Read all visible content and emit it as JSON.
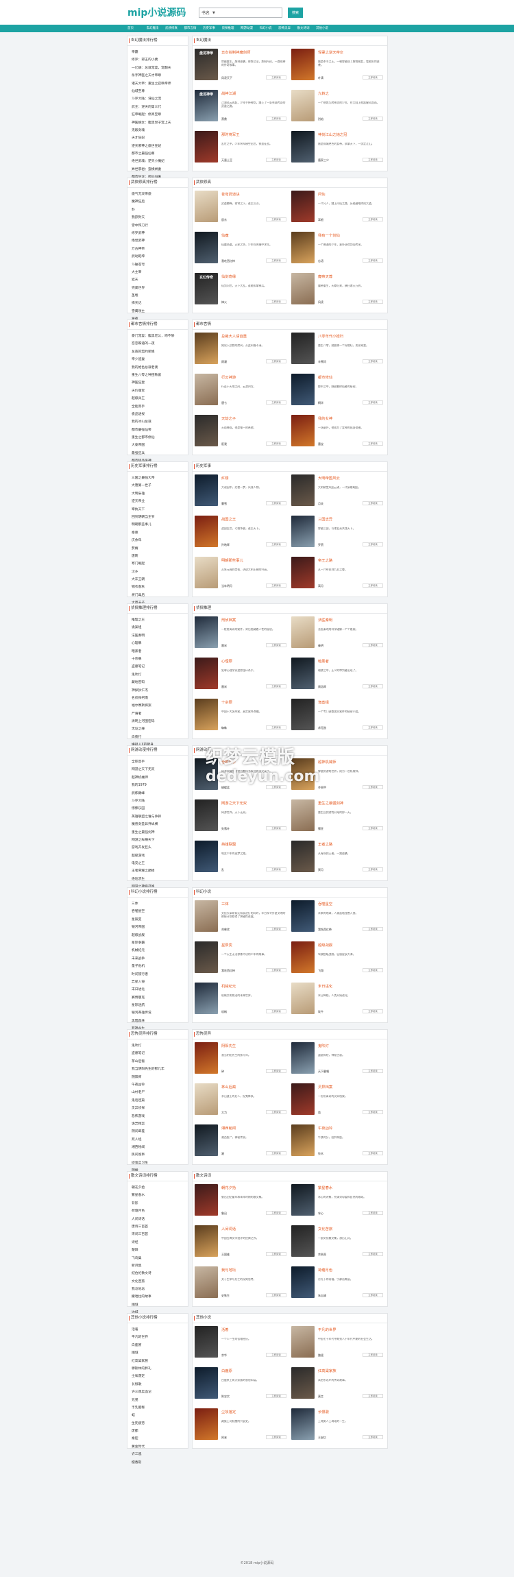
{
  "site": {
    "logo": "mip小说源码",
    "search_select": "书名",
    "search_button": "搜索"
  },
  "nav": [
    "首页",
    "玄幻魔法",
    "武侠修真",
    "都市言情",
    "历史军事",
    "侦探推理",
    "网游动漫",
    "科幻小说",
    "恐怖灵异",
    "散文诗词",
    "其他小说"
  ],
  "read_label": "立即阅读",
  "sections": [
    {
      "rank_title": "玄幻魔法排行榜",
      "cat_title": "玄幻魔法",
      "rank": [
        "帝霸",
        "修罗：邪王的小姨",
        "一亿嫡：总裁宠妻，宠翻天",
        "杀手神医之天才帝尊",
        "诸天大帝：重生之召唤帝师",
        "仙城至尊",
        "斗罗大陆：诛仙之宠",
        "武王：逆天的第三代",
        "狂帝崛起：修真至尊",
        "神医嫡女：腹黑世子宠上天",
        "无敌剑魂",
        "天才狂妃",
        "逆天邪神之傲世狂妃",
        "都市之最强仙尊",
        "绝世武魂：逆天小魔妃",
        "异世邪君：蛮横娇妻",
        "都市狂龙：修仙归来",
        "天道至尊"
      ],
      "books": [
        {
          "cover": "盘龙神帝",
          "title": "丑女控制神魔剑师",
          "author": "风凌天下",
          "desc": "穿越重生，废材逆袭，修炼功法，炼制丹药，一路成神的传奇故事。"
        },
        {
          "cover": "",
          "title": "悍妻之逆天帝女",
          "author": "叶清",
          "desc": "她是杀手之王，一朝穿越成了废物嫡女，看她如何逆袭。"
        },
        {
          "cover": "盘龙神帝",
          "title": "战神江湖",
          "author": "萧鼎",
          "desc": "江湖风云再起，少年手持神剑，踏上了一条充满传奇的武道之路。"
        },
        {
          "cover": "",
          "title": "九转之",
          "author": "烈焰",
          "desc": "一个修炼九转神功的少年，在大陆上掀起腥风血雨。"
        },
        {
          "cover": "",
          "title": "那时将军王",
          "author": "天蚕土豆",
          "desc": "乱世之中，少年将军横空出世，铁血征战。"
        },
        {
          "cover": "",
          "title": "神剑江山之她之冠",
          "author": "唐家三少",
          "desc": "她是倾城绝色的女帝，执掌天下，一剑定江山。"
        }
      ]
    },
    {
      "rank_title": "武侠修真排行榜",
      "cat_title": "武侠修真",
      "rank": [
        "傲气无双帝傲",
        "魔神狂后",
        "卦",
        "我欲封天",
        "雪中悍刀行",
        "修罗武神",
        "绝世武神",
        "万古神帝",
        "武动乾坤",
        "斗破苍穹",
        "大主宰",
        "遮天",
        "完美世界",
        "圣墟",
        "择天记",
        "雪鹰领主",
        "将夜",
        "龙王传说"
      ],
      "books": [
        {
          "cover": "",
          "title": "苍穹武道诀",
          "author": "辰东",
          "desc": "武道巅峰，苍穹之下，谁主沉浮。"
        },
        {
          "cover": "",
          "title": "问仙",
          "author": "耳根",
          "desc": "一介凡人，踏上问仙之路，历经磨难终成大道。"
        },
        {
          "cover": "",
          "title": "仙魔",
          "author": "我吃西红柿",
          "desc": "仙魔两道，正邪之争，少年在夹缝中求生。"
        },
        {
          "cover": "",
          "title": "我有一个剑仙",
          "author": "忘语",
          "desc": "一个普通的少年，意外获得剑仙传承。"
        },
        {
          "cover": "玄幻传奇",
          "title": "仙剑奇缘",
          "author": "烽火",
          "desc": "仙剑问世，天下大乱，谁能执掌神兵。"
        },
        {
          "cover": "",
          "title": "魔帝天尊",
          "author": "风凌",
          "desc": "魔帝重生，天尊归来，横扫诸天万界。"
        }
      ]
    },
    {
      "rank_title": "都市言情排行榜",
      "cat_title": "都市言情",
      "rank": [
        "豪门宠妻：腹黑老公，吻不够",
        "恋恋蝶语的一夜",
        "总裁的契约新娘",
        "帝少追妻",
        "我的绝色总裁老婆",
        "重生八零之种田致富",
        "神医狂妻",
        "天价萌宝",
        "超级兵王",
        "全能高手",
        "极品透视",
        "我的冰山总裁",
        "都市最强仙帝",
        "重生之都市修仙",
        "大秦帝国",
        "最强狂兵",
        "都市极品医神",
        "神级奶爸"
      ],
      "books": [
        {
          "cover": "",
          "title": "总裁大人请自重",
          "author": "顾漫",
          "desc": "她误入总裁的房间，从此纠缠不清。"
        },
        {
          "cover": "",
          "title": "八零年代小媳妇",
          "author": "辛夷坞",
          "desc": "重生八零，她要做一个好媳妇，发家致富。"
        },
        {
          "cover": "",
          "title": "行云神游",
          "author": "唐七",
          "desc": "行走于天地之间，云游四方。"
        },
        {
          "cover": "",
          "title": "都市修仙",
          "author": "桐华",
          "desc": "都市之中，隐藏着修仙者的秘密。"
        },
        {
          "cover": "",
          "title": "天劫之子",
          "author": "匪我",
          "desc": "天劫降临，他是唯一的希望。"
        },
        {
          "cover": "",
          "title": "我的女神",
          "author": "墨宝",
          "desc": "一场意外，他成为了女神的贴身保镖。"
        }
      ]
    },
    {
      "rank_title": "历史军事排行榜",
      "cat_title": "历史军事",
      "rank": [
        "三国之最强大帝",
        "大唐第一世子",
        "大明枭雄",
        "逆天帝业",
        "宰执天下",
        "回到明朝当王爷",
        "明朝那些事儿",
        "秦吏",
        "庆余年",
        "赘婿",
        "唐砖",
        "寒门崛起",
        "汉乡",
        "大宋王朝",
        "锦衣春秋",
        "将门毒后",
        "大周天子",
        "帝国风云"
      ],
      "books": [
        {
          "cover": "",
          "title": "红楼",
          "author": "曹雪",
          "desc": "大观园中，红楼一梦，风流人物。"
        },
        {
          "cover": "",
          "title": "大明帝国风云",
          "author": "月关",
          "desc": "大明朝堂风起云涌，一代枭雄崛起。"
        },
        {
          "cover": "",
          "title": "战国之王",
          "author": "孙皓晖",
          "desc": "战国乱世，七雄争霸，谁主天下。"
        },
        {
          "cover": "",
          "title": "三国志异",
          "author": "罗贯",
          "desc": "穿越三国，与诸葛亮共谋天下。"
        },
        {
          "cover": "",
          "title": "明朝那些事儿",
          "author": "当年明月",
          "desc": "从朱元璋到崇祯，讲述大明王朝的兴衰。"
        },
        {
          "cover": "",
          "title": "帝王之路",
          "author": "高月",
          "desc": "从一介布衣到九五之尊。"
        }
      ]
    },
    {
      "rank_title": "侦探推理排行榜",
      "cat_title": "侦探推理",
      "rank": [
        "推理之王",
        "诡案组",
        "法医秦明",
        "心理罪",
        "暗黑者",
        "十宗罪",
        "盗墓笔记",
        "鬼吹灯",
        "藏地密码",
        "神探狄仁杰",
        "名侦探柯南",
        "福尔摩斯探案",
        "尸语者",
        "清明上河图密码",
        "无证之罪",
        "白夜行",
        "嫌疑人X的献身",
        "恶意"
      ],
      "books": [
        {
          "cover": "",
          "title": "刑侦档案",
          "author": "雷米",
          "desc": "一桩桩离奇的案件，背后隐藏着人性的秘密。"
        },
        {
          "cover": "",
          "title": "法医秦明",
          "author": "秦明",
          "desc": "法医秦明用科学破解一个个悬案。"
        },
        {
          "cover": "",
          "title": "心理罪",
          "author": "雷米",
          "desc": "犯罪心理学家追踪连环杀手。"
        },
        {
          "cover": "",
          "title": "暗黑者",
          "author": "周浩晖",
          "desc": "暗夜之中，正义的审判者出现了。"
        },
        {
          "cover": "",
          "title": "十宗罪",
          "author": "蜘蛛",
          "desc": "中国十大凶杀案，真实案件改编。"
        },
        {
          "cover": "",
          "title": "诡案组",
          "author": "求无欲",
          "desc": "一个专门调查诡异案件的秘密小组。"
        }
      ]
    },
    {
      "rank_title": "网游动漫排行榜",
      "cat_title": "网游动漫",
      "rank": [
        "全职高手",
        "网游之天下无双",
        "超神机械师",
        "我的1979",
        "武炼巅峰",
        "斗罗大陆",
        "惊悚乐园",
        "英雄联盟之谁与争锋",
        "魔兽剑圣异界纵横",
        "重生之最强剑神",
        "网游之纵横天下",
        "游戏开发巨头",
        "超级游戏",
        "电竞之王",
        "王者荣耀之巅峰",
        "绝地求生",
        "网游之神级召唤",
        "全球高武"
      ],
      "books": [
        {
          "cover": "",
          "title": "全职高手",
          "author": "蝴蝶蓝",
          "desc": "网游荣耀中被誉为教科书级别的顶尖高手。"
        },
        {
          "cover": "",
          "title": "超神机械师",
          "author": "齐佩甲",
          "desc": "穿越到游戏世界，成为一名机械师。"
        },
        {
          "cover": "",
          "title": "网游之天下无双",
          "author": "失落叶",
          "desc": "网游世界，天下无双。"
        },
        {
          "cover": "",
          "title": "重生之最强剑神",
          "author": "蜀狂",
          "desc": "重生回到游戏开始的那一天。"
        },
        {
          "cover": "",
          "title": "英雄联盟",
          "author": "乱",
          "desc": "电竞少年的逐梦之路。"
        },
        {
          "cover": "",
          "title": "王者之路",
          "author": "冥月",
          "desc": "从青铜到王者，一路逆袭。"
        }
      ]
    },
    {
      "rank_title": "科幻小说排行榜",
      "cat_title": "科幻小说",
      "rank": [
        "三体",
        "吞噬星空",
        "星辰变",
        "银河帝国",
        "超级战舰",
        "星际争霸",
        "机械纪元",
        "未来战争",
        "量子危机",
        "时间旅行者",
        "异星入侵",
        "末日进化",
        "赛博朋克",
        "星际迷航",
        "银河英雄传说",
        "黑暗森林",
        "死神永生",
        "流浪地球"
      ],
      "books": [
        {
          "cover": "",
          "title": "三体",
          "author": "刘慈欣",
          "desc": "文化大革命如火如荼进行的同时，军方探寻外星文明的绝秘计划取得了突破性进展。"
        },
        {
          "cover": "",
          "title": "吞噬星空",
          "author": "我吃西红柿",
          "desc": "未来的地球，人类面临怪兽入侵。"
        },
        {
          "cover": "",
          "title": "星辰变",
          "author": "我吃西红柿",
          "desc": "一个天生无法修炼内功的少年的故事。"
        },
        {
          "cover": "",
          "title": "超级战舰",
          "author": "飞翔",
          "desc": "驾驶超级战舰，征服星辰大海。"
        },
        {
          "cover": "",
          "title": "机械纪元",
          "author": "机械",
          "desc": "机械文明统治的未来世界。"
        },
        {
          "cover": "",
          "title": "末日进化",
          "author": "吹牛",
          "desc": "末日降临，人类开始进化。"
        }
      ]
    },
    {
      "rank_title": "恐怖灵异排行榜",
      "cat_title": "恐怖灵异",
      "rank": [
        "鬼吹灯",
        "盗墓笔记",
        "茅山后裔",
        "我当阴阳先生的那几年",
        "阴阳师",
        "午夜凶铃",
        "山村老尸",
        "鬼话连篇",
        "灵异侦探",
        "恐怖游戏",
        "诡异档案",
        "阴间邮差",
        "死人经",
        "湘西秘闻",
        "民间诡事",
        "捉鬼实习生",
        "阴婚",
        "冥婚"
      ],
      "books": [
        {
          "cover": "",
          "title": "阴阳先生",
          "author": "钟",
          "desc": "我当阴阳先生的那几年。"
        },
        {
          "cover": "",
          "title": "鬼吹灯",
          "author": "天下霸唱",
          "desc": "盗墓探险，神秘古墓。"
        },
        {
          "cover": "",
          "title": "茅山后裔",
          "author": "大力",
          "desc": "茅山道士的后人，捉鬼降妖。"
        },
        {
          "cover": "",
          "title": "灵异档案",
          "author": "诡",
          "desc": "一份份离奇的灵异档案。"
        },
        {
          "cover": "",
          "title": "湘西秘闻",
          "author": "湘",
          "desc": "湘西赶尸，神秘传说。"
        },
        {
          "cover": "",
          "title": "午夜凶铃",
          "author": "铃木",
          "desc": "午夜时分，凶铃响起。"
        }
      ]
    },
    {
      "rank_title": "散文诗词排行榜",
      "cat_title": "散文诗词",
      "rank": [
        "朝花夕拾",
        "繁星春水",
        "背影",
        "荷塘月色",
        "人间词话",
        "唐诗三百首",
        "宋词三百首",
        "诗经",
        "楚辞",
        "飞鸟集",
        "新月集",
        "纪伯伦散文诗",
        "文化苦旅",
        "我与地坛",
        "撒哈拉的故事",
        "围城",
        "边城",
        "呼兰河传"
      ],
      "books": [
        {
          "cover": "",
          "title": "朝花夕拾",
          "author": "鲁迅",
          "desc": "鲁迅回忆童年和青年时期的散文集。"
        },
        {
          "cover": "",
          "title": "繁星春水",
          "author": "冰心",
          "desc": "冰心的诗集，充满对母爱和自然的歌颂。"
        },
        {
          "cover": "",
          "title": "人间词话",
          "author": "王国维",
          "desc": "中国古典文学批评的经典之作。"
        },
        {
          "cover": "",
          "title": "文化苦旅",
          "author": "余秋雨",
          "desc": "一部文化散文集，游历山河。"
        },
        {
          "cover": "",
          "title": "我与地坛",
          "author": "史铁生",
          "desc": "关于生命与死亡的深刻思考。"
        },
        {
          "cover": "",
          "title": "荷塘月色",
          "author": "朱自清",
          "desc": "月光下的荷塘，宁静而美丽。"
        }
      ]
    },
    {
      "rank_title": "其他小说排行榜",
      "cat_title": "其他小说",
      "rank": [
        "活着",
        "平凡的世界",
        "白鹿原",
        "围城",
        "红高粱家族",
        "穆斯林的葬礼",
        "尘埃落定",
        "长恨歌",
        "许三观卖血记",
        "兄弟",
        "丰乳肥臀",
        "蛙",
        "生死疲劳",
        "废都",
        "秦腔",
        "黄金时代",
        "许三观",
        "檀香刑"
      ],
      "books": [
        {
          "cover": "",
          "title": "活着",
          "author": "余华",
          "desc": "一个人一生的苦难经历。"
        },
        {
          "cover": "",
          "title": "平凡的世界",
          "author": "路遥",
          "desc": "中国七十年代中期到八十年代中期的社会生活。"
        },
        {
          "cover": "",
          "title": "白鹿原",
          "author": "陈忠实",
          "desc": "白鹿原上两大家族的恩怨纠葛。"
        },
        {
          "cover": "",
          "title": "红高粱家族",
          "author": "莫言",
          "desc": "高密东北乡的传奇故事。"
        },
        {
          "cover": "",
          "title": "尘埃落定",
          "author": "阿来",
          "desc": "藏族土司制度的兴衰史。"
        },
        {
          "cover": "",
          "title": "长恨歌",
          "author": "王安忆",
          "desc": "上海女人王琦瑶的一生。"
        }
      ]
    }
  ],
  "watermark": {
    "line1": "织梦云模版",
    "line2": "dedeyun.com"
  },
  "footer": "©2018 mip小说源码"
}
